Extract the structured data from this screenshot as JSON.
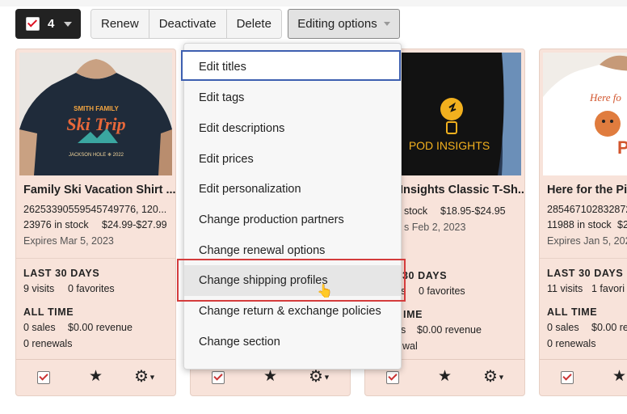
{
  "toolbar": {
    "selected_count": "4",
    "buttons": [
      "Renew",
      "Deactivate",
      "Delete"
    ],
    "editing_options": "Editing options"
  },
  "menu": {
    "items": [
      "Edit titles",
      "Edit tags",
      "Edit descriptions",
      "Edit prices",
      "Edit personalization",
      "Change production partners",
      "Change renewal options",
      "Change shipping profiles",
      "Change return & exchange policies",
      "Change section"
    ]
  },
  "cards": [
    {
      "title": "Family Ski Vacation Shirt ...",
      "sku": "2625339055954574977​6, 120...",
      "stock": "23976 in stock",
      "price": "$24.99-$27.99",
      "expires": "Expires Mar 5, 2023",
      "last30_header": "LAST 30 DAYS",
      "visits": "9 visits",
      "favorites": "0 favorites",
      "alltime_header": "ALL TIME",
      "sales": "0 sales",
      "revenue": "$0.00 revenue",
      "renewals": "0 renewals",
      "shirt_text": [
        "SMITH FAMILY",
        "Ski Trip",
        "JACKSON HOLE ❄ 2022"
      ]
    },
    {
      "title": "",
      "sku": "",
      "stock": "",
      "price": "",
      "expires": "",
      "last30_header": "",
      "visits": "",
      "favorites": "",
      "alltime_header": "",
      "sales": "",
      "revenue": "",
      "renewals": ""
    },
    {
      "title": "Insights Classic T-Sh...",
      "stock": "stock",
      "price": "$18.95-$24.95",
      "expires": "s Feb 2, 2023",
      "last30_header": "30 DAYS",
      "visits": "s",
      "favorites": "0 favorites",
      "alltime_header": "IME",
      "sales": "s",
      "revenue": "$0.00 revenue",
      "renewals": "wal",
      "shirt_text": "POD INSIGHTS"
    },
    {
      "title": "Here for the Pie",
      "sku": "285467102832872",
      "stock": "11988 in stock",
      "price": "$22.",
      "expires": "Expires Jan 5, 2023",
      "last30_header": "LAST 30 DAYS",
      "visits": "11 visits",
      "favorites": "1 favori",
      "alltime_header": "ALL TIME",
      "sales": "0 sales",
      "revenue": "$0.00 re",
      "renewals": "0 renewals",
      "shirt_text": [
        "Here fo",
        "PI"
      ]
    }
  ],
  "colors": {
    "card_bg": "#f8e3da",
    "menu_focus_border": "#3d5fb0",
    "annotation_red": "#d43c3c"
  }
}
